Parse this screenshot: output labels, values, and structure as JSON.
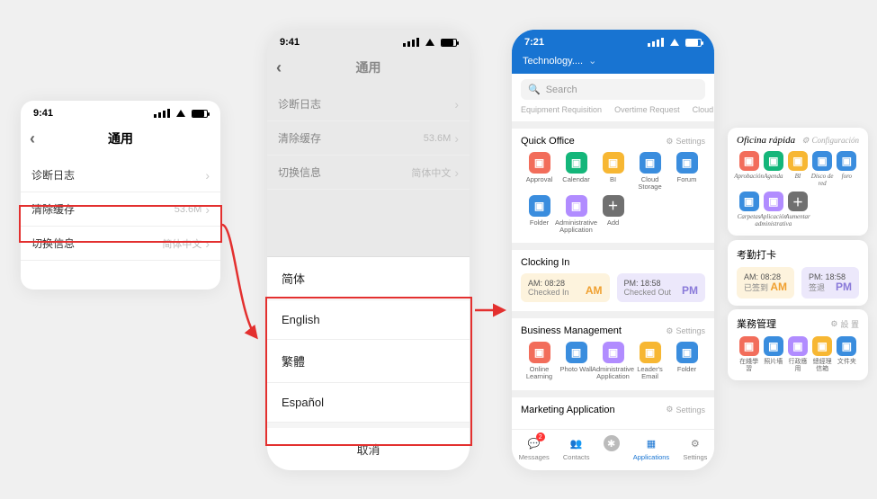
{
  "status": {
    "time1": "9:41",
    "time2": "9:41",
    "time3": "7:21"
  },
  "phone1": {
    "title": "通用",
    "rows": [
      {
        "k": "诊断日志",
        "v": ""
      },
      {
        "k": "清除缓存",
        "v": "53.6M"
      },
      {
        "k": "切换信息",
        "v": "简体中文"
      }
    ]
  },
  "phone2": {
    "title": "通用",
    "rows": [
      {
        "k": "诊断日志",
        "v": ""
      },
      {
        "k": "清除缓存",
        "v": "53.6M"
      },
      {
        "k": "切换信息",
        "v": "简体中文"
      }
    ],
    "options": [
      "简体",
      "English",
      "繁體",
      "Español"
    ],
    "cancel": "取消"
  },
  "phone3": {
    "org": "Technology....",
    "search_ph": "Search",
    "tabs": [
      "Equipment Requisition",
      "Overtime Request",
      "Cloud Sto"
    ],
    "quick": {
      "title": "Quick Office",
      "settings": "Settings",
      "apps": [
        {
          "lb": "Approval",
          "c": "#f26d5b"
        },
        {
          "lb": "Calendar",
          "c": "#14b67a"
        },
        {
          "lb": "BI",
          "c": "#f7b733"
        },
        {
          "lb": "Cloud Storage",
          "c": "#3a8dde"
        },
        {
          "lb": "Forum",
          "c": "#3a8dde"
        },
        {
          "lb": "Folder",
          "c": "#3a8dde"
        },
        {
          "lb": "Administrative Application",
          "c": "#b18cff"
        },
        {
          "lb": "Add",
          "c": "#707070"
        }
      ]
    },
    "clock": {
      "title": "Clocking In",
      "am_l1": "AM: 08:28",
      "am_l2": "Checked In",
      "am": "AM",
      "pm_l1": "PM: 18:58",
      "pm_l2": "Checked Out",
      "pm": "PM"
    },
    "biz": {
      "title": "Business Management",
      "settings": "Settings",
      "apps": [
        {
          "lb": "Online Learning",
          "c": "#f26d5b"
        },
        {
          "lb": "Photo Wall",
          "c": "#3a8dde"
        },
        {
          "lb": "Administrative Application",
          "c": "#b18cff"
        },
        {
          "lb": "Leader's Email",
          "c": "#f7b733"
        },
        {
          "lb": "Folder",
          "c": "#3a8dde"
        }
      ]
    },
    "mkt": {
      "title": "Marketing Application",
      "settings": "Settings"
    },
    "nav": [
      "Messages",
      "Contacts",
      "",
      "Applications",
      "Settings"
    ]
  },
  "float1": {
    "title": "Oficina rápida",
    "settings": "Configuración",
    "apps": [
      {
        "lb": "Aprobación",
        "c": "#f26d5b"
      },
      {
        "lb": "Agenda",
        "c": "#14b67a"
      },
      {
        "lb": "BI",
        "c": "#f7b733"
      },
      {
        "lb": "Disco de red",
        "c": "#3a8dde"
      },
      {
        "lb": "foro",
        "c": "#3a8dde"
      },
      {
        "lb": "Carpetas",
        "c": "#3a8dde"
      },
      {
        "lb": "Aplicación administrativa",
        "c": "#b18cff"
      },
      {
        "lb": "Aumentar",
        "c": "#707070"
      }
    ]
  },
  "float2": {
    "title": "考勤打卡",
    "am_l1": "AM: 08:28",
    "am_l2": "已签到",
    "am": "AM",
    "pm_l1": "PM: 18:58",
    "pm_l2": "签退",
    "pm": "PM"
  },
  "float3": {
    "title": "業務管理",
    "settings": "設 置",
    "apps": [
      {
        "lb": "在綫學習",
        "c": "#f26d5b"
      },
      {
        "lb": "照片墻",
        "c": "#3a8dde"
      },
      {
        "lb": "行政應用",
        "c": "#b18cff"
      },
      {
        "lb": "總經理信箱",
        "c": "#f7b733"
      },
      {
        "lb": "文件夹",
        "c": "#3a8dde"
      }
    ]
  }
}
